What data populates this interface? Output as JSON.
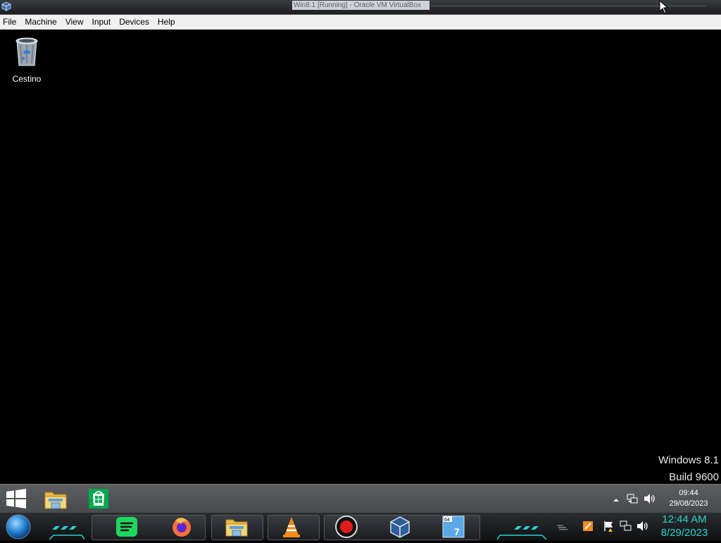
{
  "host": {
    "title": "Win8.1 [Running] - Oracle VM VirtualBox"
  },
  "menu": [
    "File",
    "Machine",
    "View",
    "Input",
    "Devices",
    "Help"
  ],
  "desktop": {
    "recycle_bin_label": "Cestino",
    "watermark": {
      "line1": "Windows 8.1",
      "line2": "Build 9600"
    }
  },
  "taskbar": {
    "pinned": [
      "windows-start-icon",
      "file-explorer-icon",
      "store-icon"
    ],
    "tray": [
      "chevron-up-icon",
      "network-icon",
      "volume-icon"
    ],
    "clock": {
      "time": "09:44",
      "date": "29/08/2023"
    }
  },
  "dock": {
    "icons": [
      "orb-icon",
      "spotify-icon",
      "firefox-icon",
      "file-explorer-icon",
      "vlc-icon",
      "record-icon",
      "virtualbox-icon",
      "windows7-64-icon"
    ],
    "tray": [
      "network-icon",
      "flag-icon",
      "network-icon",
      "volume-icon"
    ],
    "clock": {
      "time": "12:44 AM",
      "date": "8/29/2023"
    },
    "accent_color": "#27d3cf"
  },
  "colors": {
    "desktop_bg": "#000000",
    "menubar_bg": "#f0f0f0",
    "taskbar_bg": "#505255"
  }
}
